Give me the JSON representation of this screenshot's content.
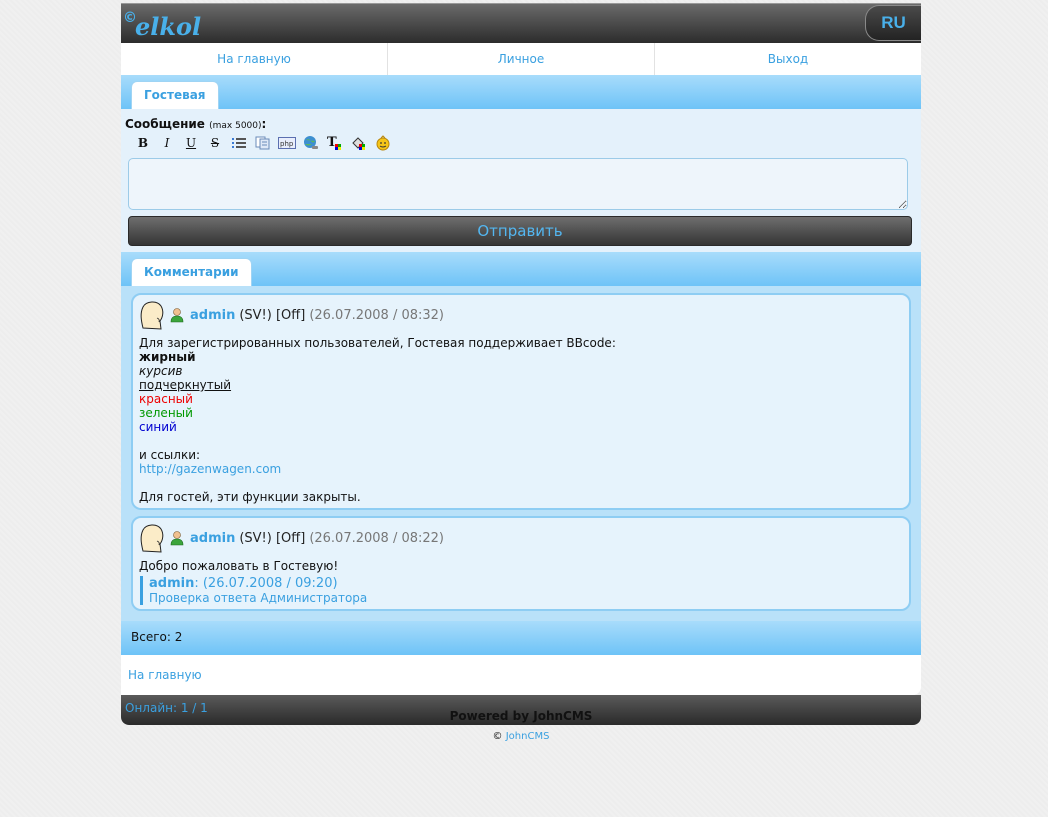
{
  "header": {
    "logo_text": "elkol",
    "logo_copy": "©",
    "lang": "RU"
  },
  "nav": {
    "items": [
      "На главную",
      "Личное",
      "Выход"
    ]
  },
  "guest_tab": "Гостевая",
  "form": {
    "label": "Сообщение",
    "limit": "(max 5000)",
    "colon": ":",
    "toolbar": [
      "bold-icon",
      "italic-icon",
      "underline-icon",
      "strike-icon",
      "list-icon",
      "quote-icon",
      "php-code-icon",
      "url-icon",
      "text-color-icon",
      "background-color-icon",
      "smiley-icon"
    ],
    "textarea_value": "",
    "submit": "Отправить"
  },
  "comments_tab": "Комментарии",
  "posts": [
    {
      "user": "admin",
      "status": "(SV!) [Off]",
      "date": "(26.07.2008 / 08:32)",
      "lines": {
        "intro": "Для зарегистрированных пользователей, Гостевая поддерживает BBcode:",
        "bold": "жирный",
        "italic": "курсив",
        "underline": "подчеркнутый",
        "red": "красный",
        "green": "зеленый",
        "blue": "синий",
        "links": "и ссылки:",
        "url": "http://gazenwagen.com",
        "closing": "Для гостей, эти функции закрыты."
      }
    },
    {
      "user": "admin",
      "status": "(SV!) [Off]",
      "date": "(26.07.2008 / 08:22)",
      "text": "Добро пожаловать в Гостевую!",
      "reply": {
        "name": "admin",
        "date": ": (26.07.2008 / 09:20)",
        "text": "Проверка ответа Администратора"
      }
    }
  ],
  "total": "Всего: 2",
  "home_link": "На главную",
  "online": {
    "label": "Онлайн:",
    "value": "1 / 1"
  },
  "powered": "Powered by JohnCMS",
  "copyright": {
    "symbol": "©",
    "link": "JohnCMS"
  },
  "colors": {
    "accent": "#3aa0e0",
    "tab_bg": "#6ec3f7",
    "header_bg": "#2c2c2c"
  }
}
